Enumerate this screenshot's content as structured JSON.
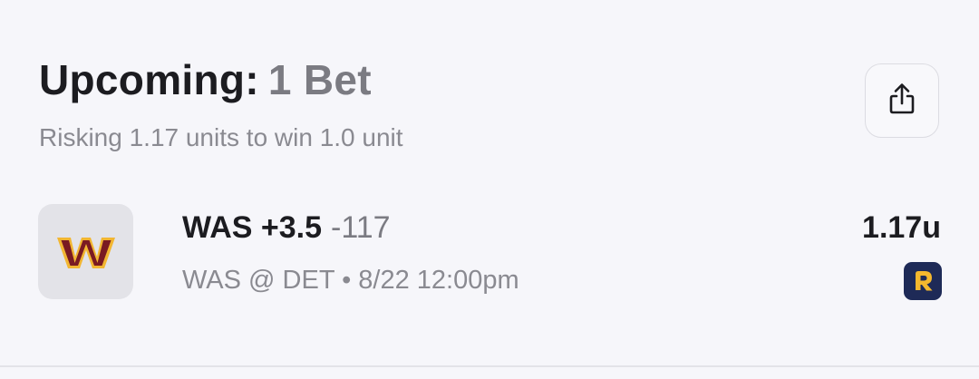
{
  "header": {
    "title": "Upcoming:",
    "count": "1 Bet",
    "subtitle": "Risking 1.17 units to win 1.0 unit"
  },
  "share": {
    "icon": "share-icon"
  },
  "bets": [
    {
      "team_logo": "washington-commanders-logo",
      "logo_letter": "W",
      "pick": "WAS +3.5",
      "odds": "-117",
      "game": "WAS @ DET • 8/22 12:00pm",
      "stake": "1.17u",
      "sportsbook_icon": "sportsbook-r-icon",
      "sportsbook_letter": "R"
    }
  ],
  "colors": {
    "background": "#f6f6fa",
    "text_primary": "#1c1c20",
    "text_secondary": "#8a8a91",
    "logo_burgundy": "#7a1a22",
    "logo_gold": "#f2b632",
    "sportsbook_navy": "#1e2a57"
  }
}
